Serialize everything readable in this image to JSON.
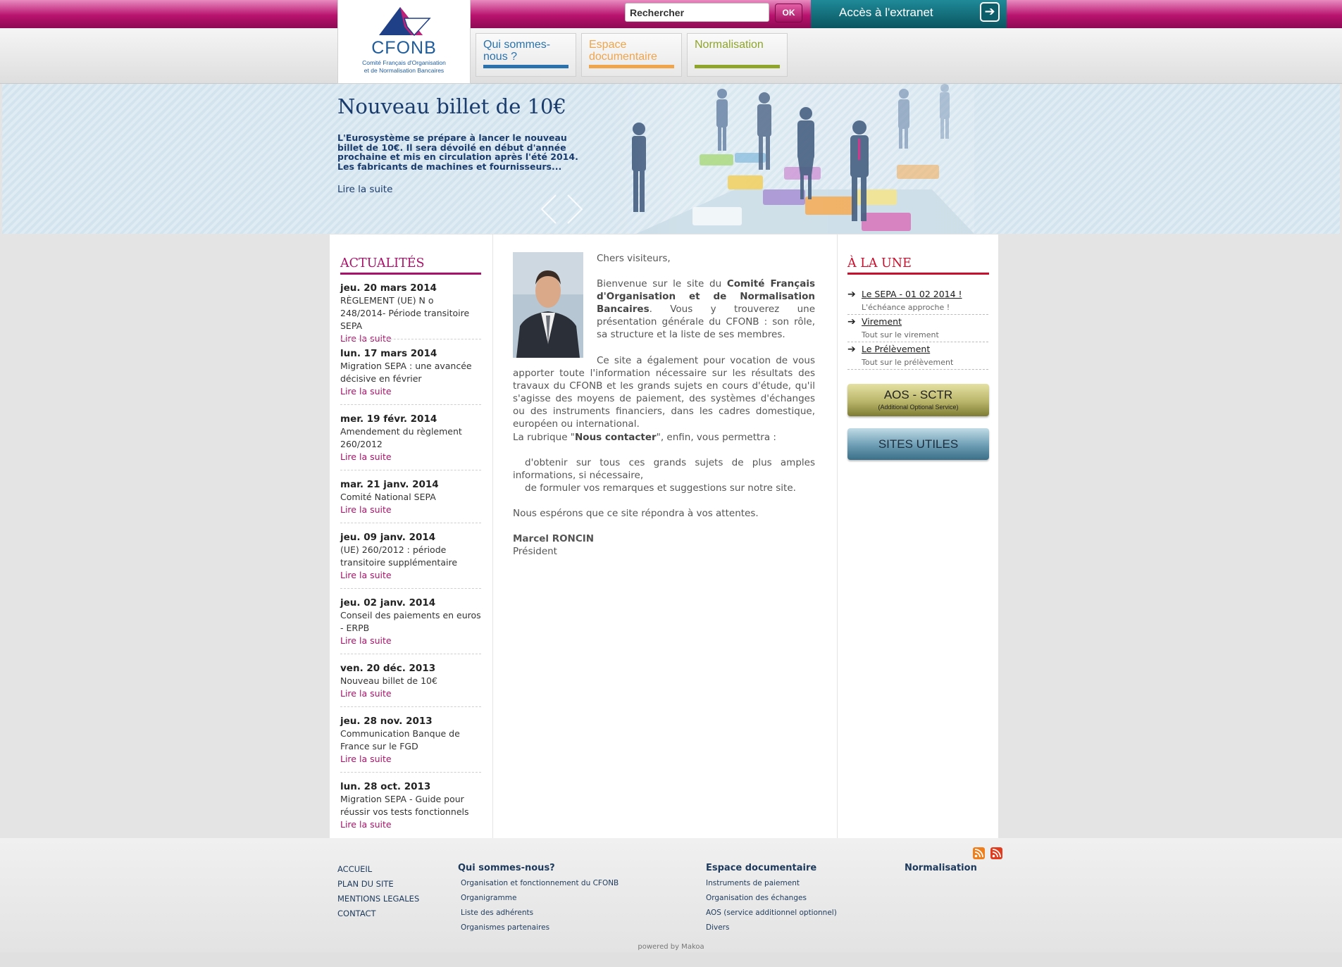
{
  "header": {
    "logo_name": "CFONB",
    "logo_sub_line1": "Comité Français d'Organisation",
    "logo_sub_line2": "et de Normalisation Bancaires",
    "search_placeholder": "Rechercher",
    "ok_label": "OK",
    "extranet_label": "Accès à l'extranet"
  },
  "nav": {
    "tabs": [
      {
        "label": "Qui sommes-nous ?",
        "color": "#2a72ad"
      },
      {
        "label": "Espace documentaire",
        "color": "#f0a54b"
      },
      {
        "label": "Normalisation",
        "color": "#8fa52a"
      }
    ]
  },
  "banner": {
    "title": "Nouveau billet de 10€",
    "text": "L'Eurosystème se prépare à lancer le nouveau billet de 10€. Il sera dévoilé en début d'année prochaine et mis en circulation après l'été 2014. Les fabricants de machines et fournisseurs...",
    "link": "Lire la suite"
  },
  "actualites": {
    "title": "ACTUALITÉS",
    "color": "#a8126a",
    "more_label": "Lire la suite",
    "items": [
      {
        "date": "jeu. 20 mars 2014",
        "text": "RÈGLEMENT (UE) N o 248/2014- Période transitoire SEPA"
      },
      {
        "date": "lun. 17 mars 2014",
        "text": "Migration SEPA : une avancée décisive en février"
      },
      {
        "date": "mer. 19 févr. 2014",
        "text": "Amendement du règlement 260/2012"
      },
      {
        "date": "mar. 21 janv. 2014",
        "text": "Comité National SEPA"
      },
      {
        "date": "jeu. 09 janv. 2014",
        "text": "(UE) 260/2012 : période transitoire supplémentaire"
      },
      {
        "date": "jeu. 02 janv. 2014",
        "text": "Conseil des paiements en euros - ERPB"
      },
      {
        "date": "ven. 20 déc. 2013",
        "text": "Nouveau billet de 10€"
      },
      {
        "date": "jeu. 28 nov. 2013",
        "text": "Communication Banque de France sur le FGD"
      },
      {
        "date": "lun. 28 oct. 2013",
        "text": "Migration SEPA - Guide pour réussir vos tests fonctionnels"
      }
    ]
  },
  "welcome": {
    "greeting": "Chers visiteurs,",
    "p1_a": "Bienvenue sur le site du ",
    "p1_b": "Comité Français d'Organisation et de Normalisation Bancaires",
    "p1_c": ". Vous y trouverez une présentation générale du CFONB : son rôle, sa structure et la liste de ses membres.",
    "p2": "Ce site a également pour vocation de vous apporter toute l'information nécessaire sur les résultats des travaux du CFONB et les grands sujets en cours d'étude, qu'il s'agisse des moyens de paiement, des systèmes d'échanges ou des instruments financiers, dans les cadres domestique, européen ou international.",
    "p3_a": "La rubrique \"",
    "p3_b": "Nous contacter",
    "p3_c": "\", enfin, vous permettra :",
    "bullet1": "d'obtenir sur tous ces grands sujets de plus amples informations, si nécessaire,",
    "bullet2": "de formuler vos remarques et suggestions sur notre site.",
    "p4": "Nous espérons que ce site répondra à vos attentes.",
    "signature_name": "Marcel RONCIN",
    "signature_title": "Président"
  },
  "a_la_une": {
    "title": "À LA UNE",
    "color": "#c8102e",
    "items": [
      {
        "label": "Le SEPA - 01 02 2014 !",
        "desc": "L'échéance approche !"
      },
      {
        "label": "Virement",
        "desc": "Tout sur le virement"
      },
      {
        "label": "Le Prélèvement",
        "desc": "Tout sur le prélèvement"
      }
    ],
    "aos_title": "AOS - SCTR",
    "aos_sub": "(Additional Optional Service)",
    "sites_label": "SITES UTILES"
  },
  "footer": {
    "col1": [
      "ACCUEIL",
      "PLAN DU SITE",
      "MENTIONS LEGALES",
      "CONTACT"
    ],
    "col2_head": "Qui sommes-nous?",
    "col2": [
      "Organisation et fonctionnement du CFONB",
      "Organigramme",
      "Liste des adhérents",
      "Organismes partenaires"
    ],
    "col3_head": "Espace documentaire",
    "col3": [
      "Instruments de paiement",
      "Organisation des échanges",
      "AOS (service additionnel optionnel)",
      "Divers"
    ],
    "col4_head": "Normalisation",
    "powered": "powered by Makoa"
  }
}
